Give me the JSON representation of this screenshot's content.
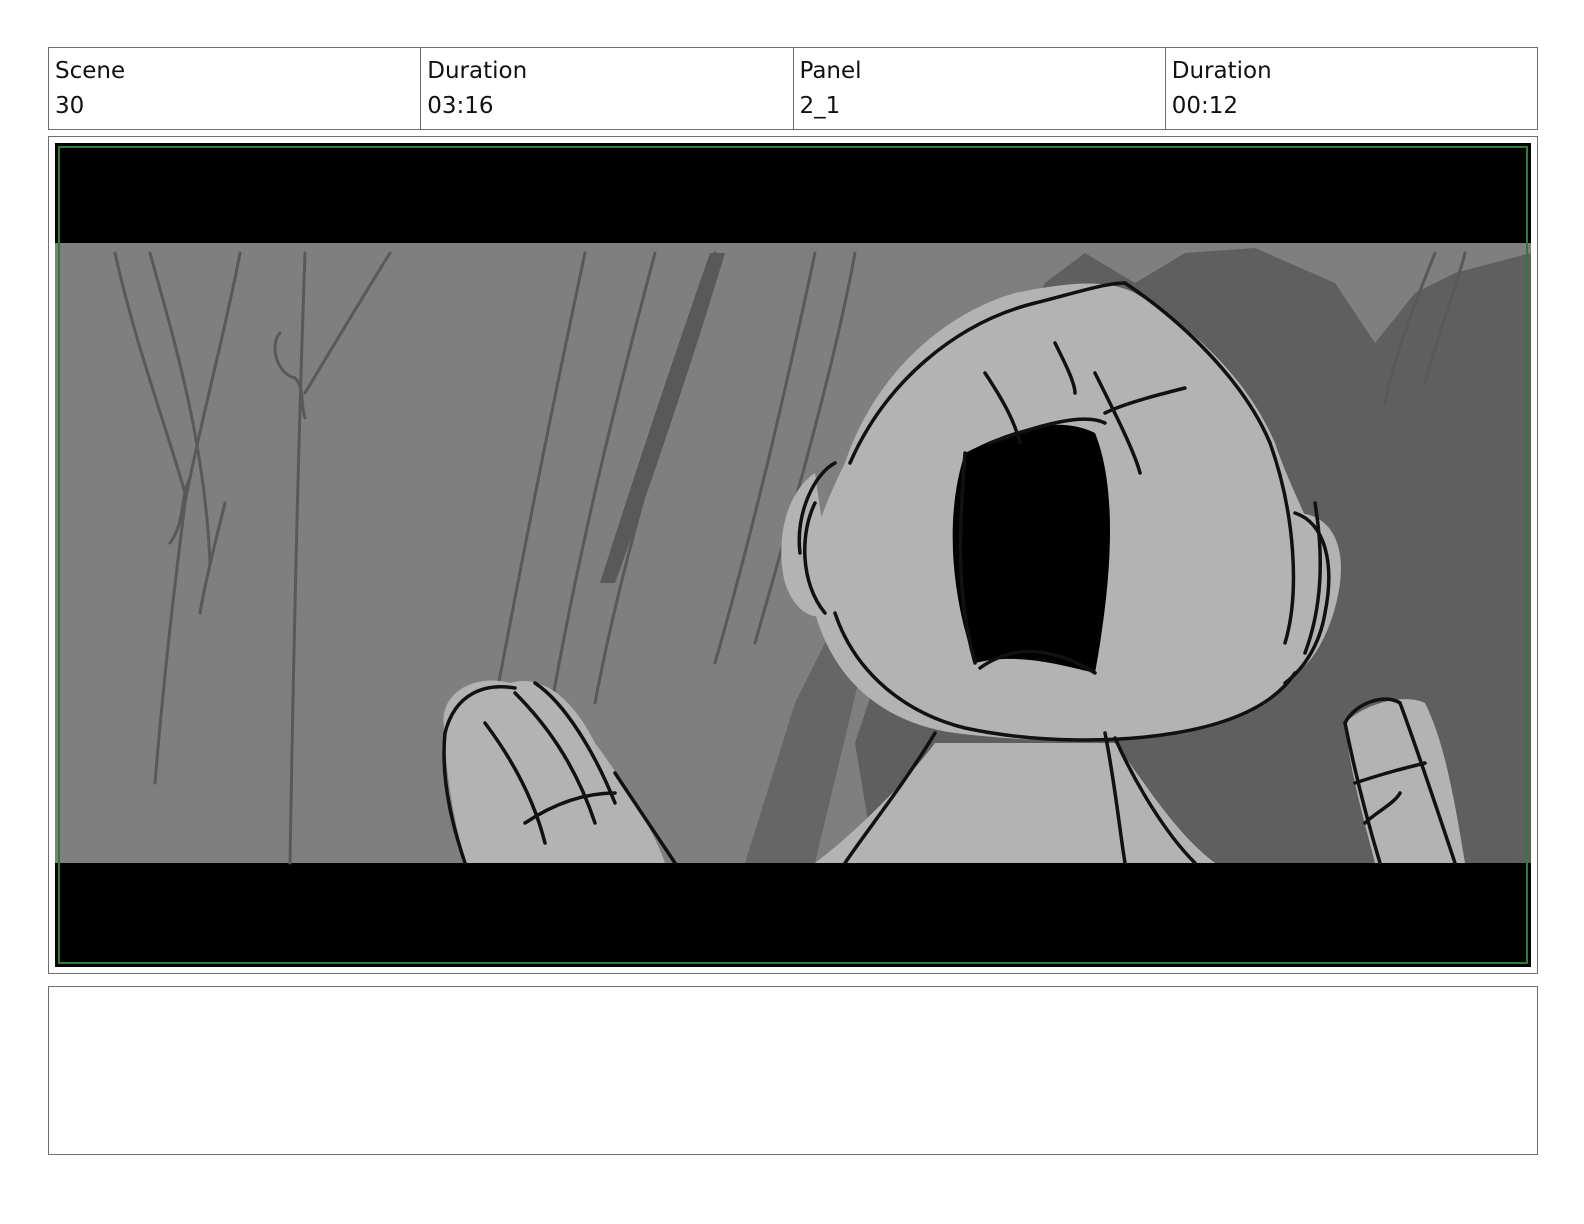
{
  "header": {
    "scene_label": "Scene",
    "scene_value": "30",
    "scene_duration_label": "Duration",
    "scene_duration_value": "03:16",
    "panel_label": "Panel",
    "panel_value": "2_1",
    "panel_duration_label": "Duration",
    "panel_duration_value": "00:12"
  },
  "colors": {
    "letterbox": "#000000",
    "background_gray": "#7f7f7f",
    "shadow_gray": "#5f5f5f",
    "character_fill": "#b3b3b3",
    "safe_area_guide": "#2e7d32"
  },
  "notes": {
    "text": ""
  }
}
